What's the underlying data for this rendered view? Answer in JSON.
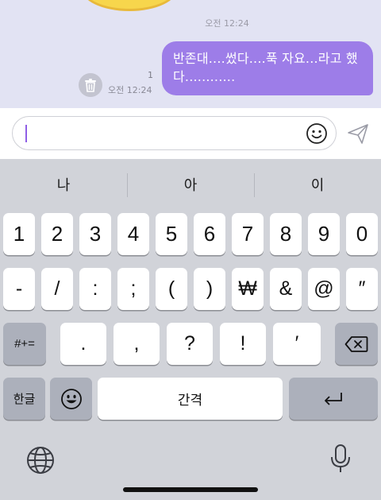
{
  "chat": {
    "time_top": "오전 12:24",
    "message_text": "반존대....썼다....푹 자요...라고 했다............",
    "unread_count": "1",
    "message_time": "오전 12:24",
    "bubble_color": "#9d7de8",
    "trash_icon": "trash-icon"
  },
  "input": {
    "placeholder": "",
    "value": "",
    "emoji_icon": "smiley-icon",
    "send_icon": "send-icon"
  },
  "suggestions": [
    "나",
    "아",
    "이"
  ],
  "keyboard": {
    "row1": [
      "1",
      "2",
      "3",
      "4",
      "5",
      "6",
      "7",
      "8",
      "9",
      "0"
    ],
    "row2": [
      "-",
      "/",
      ":",
      ";",
      "(",
      ")",
      "₩",
      "&",
      "@",
      "″"
    ],
    "row3": {
      "mode_label": "#+=",
      "keys": [
        ".",
        ",",
        "?",
        "!",
        "′"
      ],
      "backspace_icon": "backspace-icon"
    },
    "row4": {
      "lang_label": "한글",
      "emoji_icon": "emoji-icon",
      "space_label": "간격",
      "return_icon": "return-icon"
    },
    "globe_icon": "globe-icon",
    "mic_icon": "microphone-icon"
  }
}
